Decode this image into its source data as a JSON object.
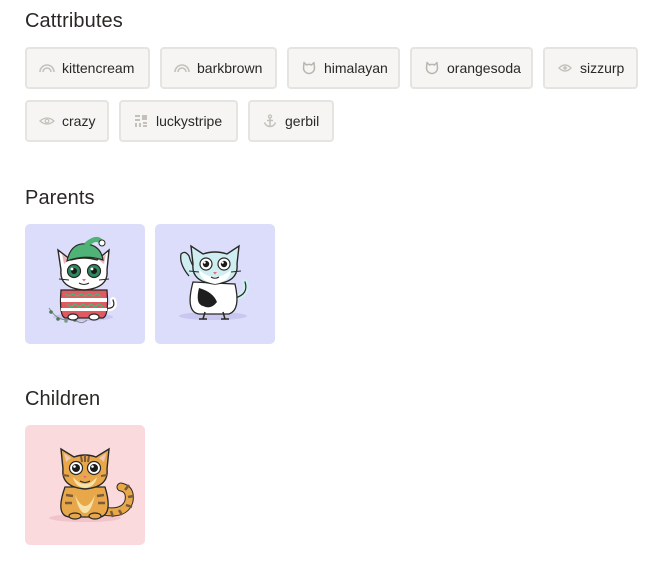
{
  "cattributes": {
    "title": "Cattributes",
    "items": [
      {
        "label": "kittencream",
        "icon": "rainbow-icon"
      },
      {
        "label": "barkbrown",
        "icon": "rainbow-icon"
      },
      {
        "label": "himalayan",
        "icon": "cat-face-icon"
      },
      {
        "label": "orangesoda",
        "icon": "cat-face-icon"
      },
      {
        "label": "sizzurp",
        "icon": "eye-icon"
      },
      {
        "label": "crazy",
        "icon": "eye-icon"
      },
      {
        "label": "luckystripe",
        "icon": "pattern-icon"
      },
      {
        "label": "gerbil",
        "icon": "anchor-icon"
      }
    ]
  },
  "parents": {
    "title": "Parents",
    "items": [
      {
        "name": "parent-kitty-1",
        "background": "#dcdcfb"
      },
      {
        "name": "parent-kitty-2",
        "background": "#dcdcfb"
      }
    ]
  },
  "children": {
    "title": "Children",
    "items": [
      {
        "name": "child-kitty-1",
        "background": "#fadadd"
      }
    ]
  },
  "colors": {
    "chip_background": "#f6f5f3",
    "chip_border": "#e6e4e0",
    "icon_gray": "#b9b6b1",
    "text": "#2a2825"
  }
}
